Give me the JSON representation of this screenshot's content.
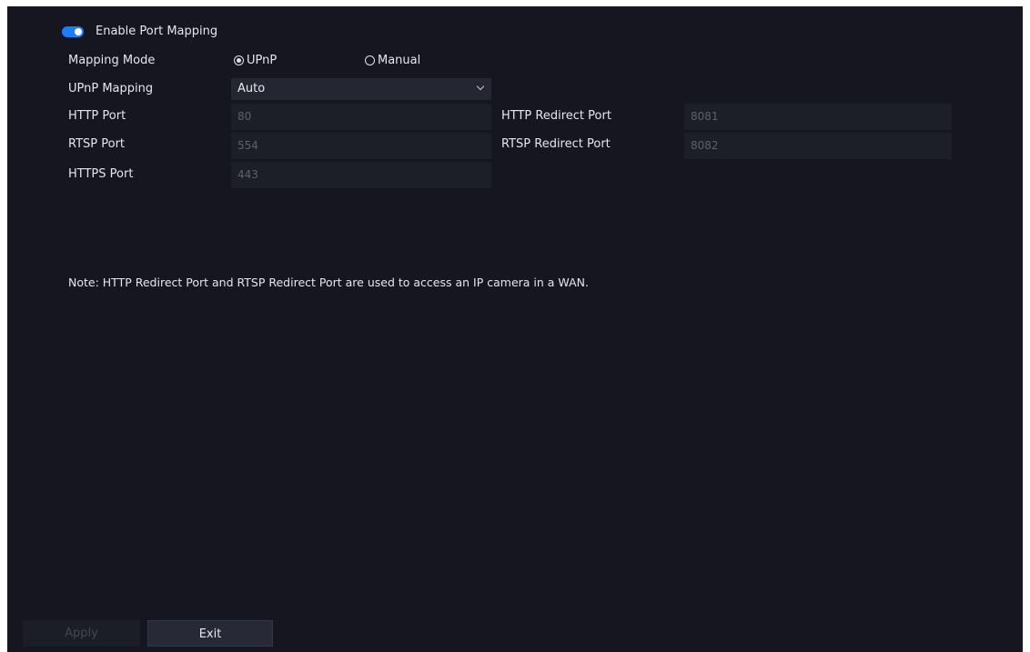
{
  "enable_port_mapping": {
    "label": "Enable Port Mapping",
    "enabled": true
  },
  "mapping_mode": {
    "label": "Mapping Mode",
    "options": [
      {
        "label": "UPnP",
        "selected": true
      },
      {
        "label": "Manual",
        "selected": false
      }
    ]
  },
  "upnp_mapping": {
    "label": "UPnP Mapping",
    "value": "Auto"
  },
  "ports": {
    "http": {
      "label": "HTTP Port",
      "value": "80"
    },
    "rtsp": {
      "label": "RTSP Port",
      "value": "554"
    },
    "https": {
      "label": "HTTPS Port",
      "value": "443"
    },
    "http_redirect": {
      "label": "HTTP Redirect Port",
      "value": "8081"
    },
    "rtsp_redirect": {
      "label": "RTSP Redirect Port",
      "value": "8082"
    }
  },
  "note": "Note: HTTP Redirect Port and RTSP Redirect Port are used to access an IP camera in a WAN.",
  "buttons": {
    "apply": "Apply",
    "exit": "Exit"
  },
  "colors": {
    "accent": "#1e7cff",
    "background": "#15161f"
  }
}
